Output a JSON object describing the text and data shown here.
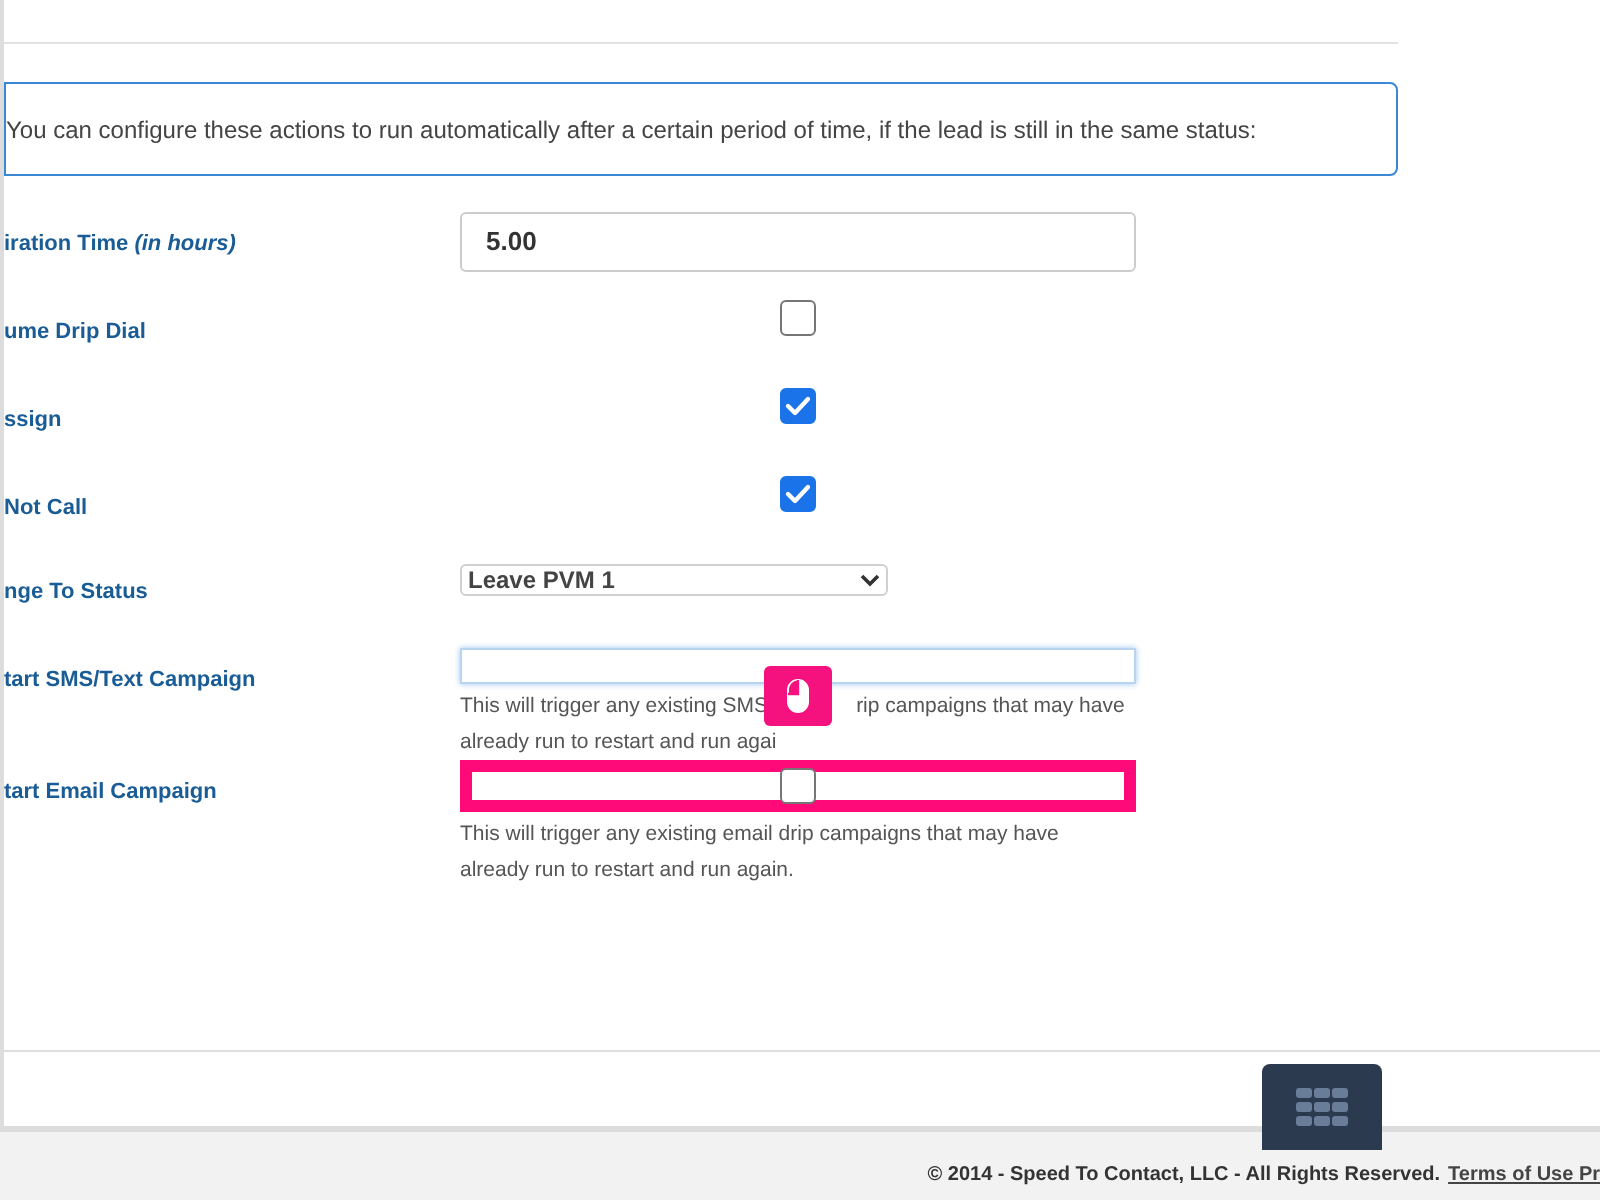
{
  "info_text": "You can configure these actions to run automatically after a certain period of time, if the lead is still in the same status:",
  "fields": [
    {
      "kind": "text",
      "label": "iration Time *(in hours)*",
      "value": "5.00"
    },
    {
      "kind": "checkbox",
      "label": "ume Drip Dial",
      "checked": false
    },
    {
      "kind": "checkbox",
      "label": "ssign",
      "checked": true
    },
    {
      "kind": "checkbox",
      "label": "Not Call",
      "checked": true
    },
    {
      "kind": "select",
      "label": "nge To Status",
      "value": "Leave PVM 1"
    },
    {
      "kind": "blank",
      "label": "tart SMS/Text Campaign",
      "help_lines": [
        [
          "This will trigger any existing SMS",
          "rip campaigns that may have"
        ],
        [
          "already run to restart and run agai"
        ]
      ]
    },
    {
      "kind": "checkbox",
      "label": "tart Email Campaign",
      "checked": false,
      "highlighted": true,
      "help_lines": [
        [
          "This will trigger any existing email drip campaigns that may have"
        ],
        [
          "already run to restart and run again."
        ]
      ]
    }
  ],
  "footer": {
    "copyright": "© 2014 - Speed To Contact, LLC - All Rights Reserved.",
    "link": "Terms of Use Pr"
  }
}
